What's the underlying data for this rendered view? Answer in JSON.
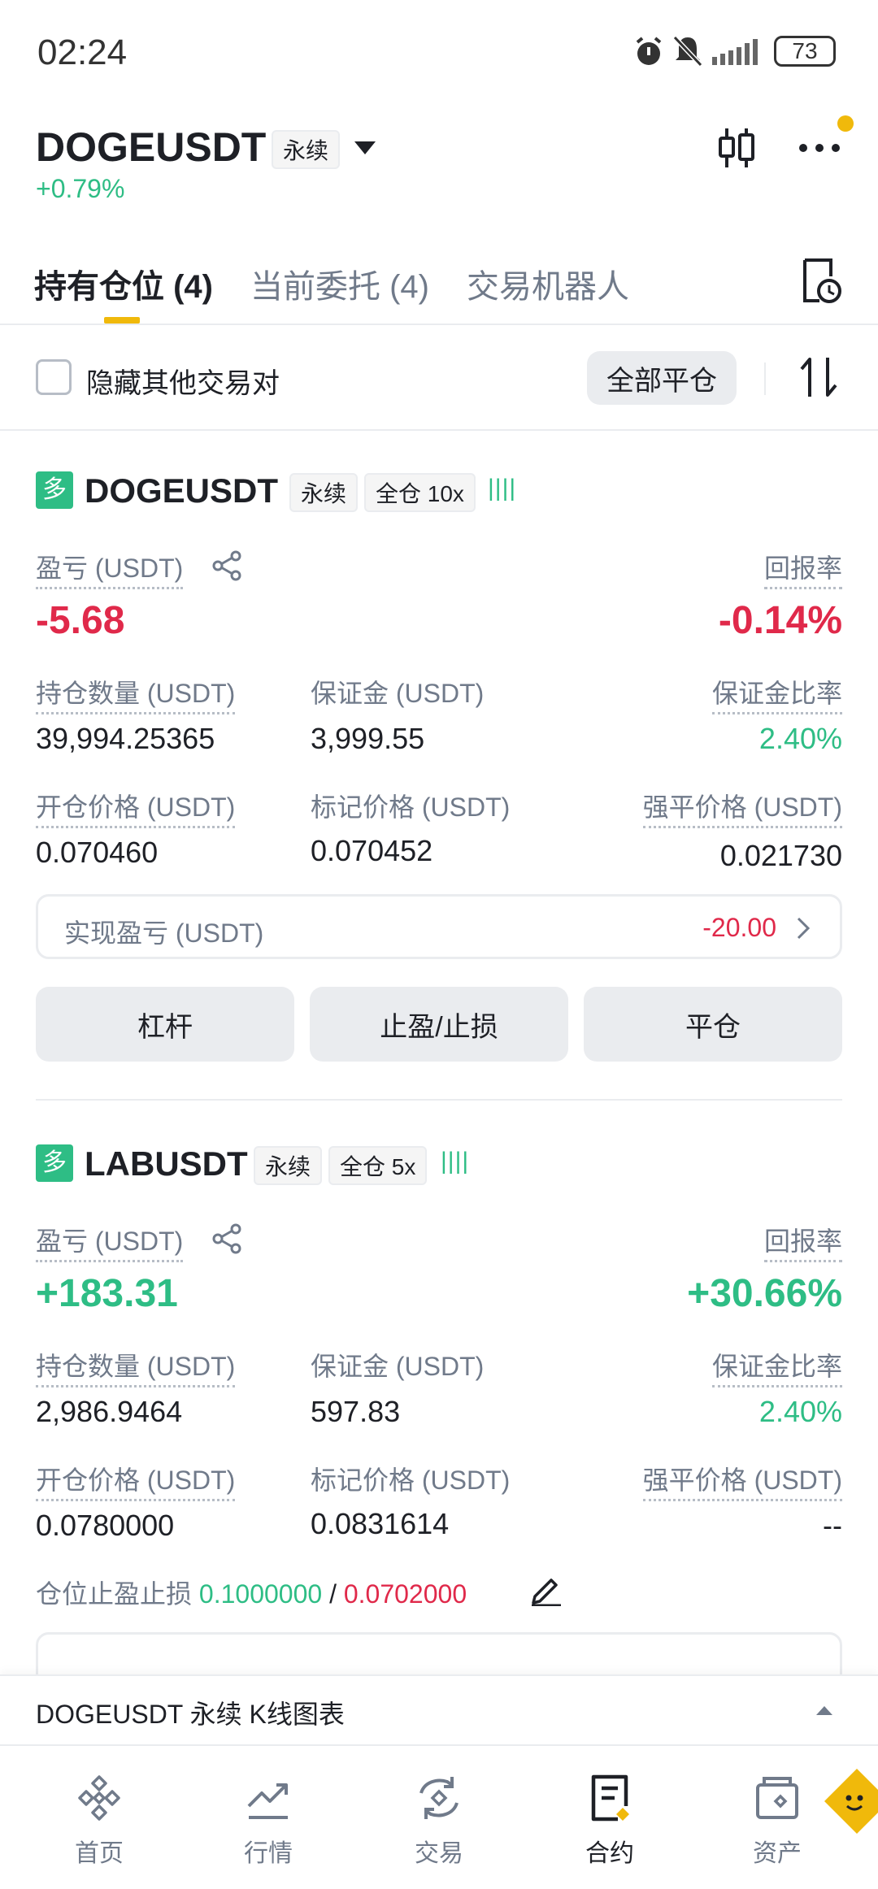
{
  "status_bar": {
    "time": "02:24",
    "battery": "73"
  },
  "header": {
    "symbol": "DOGEUSDT",
    "contract_tag": "永续",
    "change": "+0.79%"
  },
  "tabs": [
    {
      "label": "持有仓位 (4)"
    },
    {
      "label": "当前委托 (4)"
    },
    {
      "label": "交易机器人"
    }
  ],
  "filter": {
    "hide_other_label": "隐藏其他交易对",
    "close_all_label": "全部平仓"
  },
  "positions": [
    {
      "side": "多",
      "symbol": "DOGEUSDT",
      "contract_tag": "永续",
      "margin_tag": "全仓 10x",
      "pnl_label": "盈亏 (USDT)",
      "pnl_value": "-5.68",
      "roe_label": "回报率",
      "roe_value": "-0.14%",
      "size_label": "持仓数量 (USDT)",
      "size_value": "39,994.25365",
      "margin_label": "保证金 (USDT)",
      "margin_value": "3,999.55",
      "margin_ratio_label": "保证金比率",
      "margin_ratio_value": "2.40%",
      "entry_label": "开仓价格 (USDT)",
      "entry_value": "0.070460",
      "mark_label": "标记价格 (USDT)",
      "mark_value": "0.070452",
      "liq_label": "强平价格 (USDT)",
      "liq_value": "0.021730",
      "realized_label": "实现盈亏 (USDT)",
      "realized_value": "-20.00",
      "buttons": [
        "杠杆",
        "止盈/止损",
        "平仓"
      ]
    },
    {
      "side": "多",
      "symbol": "LABUSDT",
      "contract_tag": "永续",
      "margin_tag": "全仓 5x",
      "pnl_label": "盈亏 (USDT)",
      "pnl_value": "+183.31",
      "roe_label": "回报率",
      "roe_value": "+30.66%",
      "size_label": "持仓数量 (USDT)",
      "size_value": "2,986.9464",
      "margin_label": "保证金 (USDT)",
      "margin_value": "597.83",
      "margin_ratio_label": "保证金比率",
      "margin_ratio_value": "2.40%",
      "entry_label": "开仓价格 (USDT)",
      "entry_value": "0.0780000",
      "mark_label": "标记价格 (USDT)",
      "mark_value": "0.0831614",
      "liq_label": "强平价格 (USDT)",
      "liq_value": "--",
      "tpsl_label": "仓位止盈止损",
      "tp_value": "0.1000000",
      "tpsl_sep": "/",
      "sl_value": "0.0702000"
    }
  ],
  "chart_bar": {
    "label": "DOGEUSDT 永续 K线图表"
  },
  "bottom_nav": [
    {
      "label": "首页",
      "icon": "home-icon"
    },
    {
      "label": "行情",
      "icon": "markets-icon"
    },
    {
      "label": "交易",
      "icon": "trade-icon"
    },
    {
      "label": "合约",
      "icon": "futures-icon"
    },
    {
      "label": "资产",
      "icon": "assets-icon"
    }
  ],
  "colors": {
    "green": "#2ebd85",
    "red": "#e0294a",
    "accent": "#f0b90b"
  }
}
